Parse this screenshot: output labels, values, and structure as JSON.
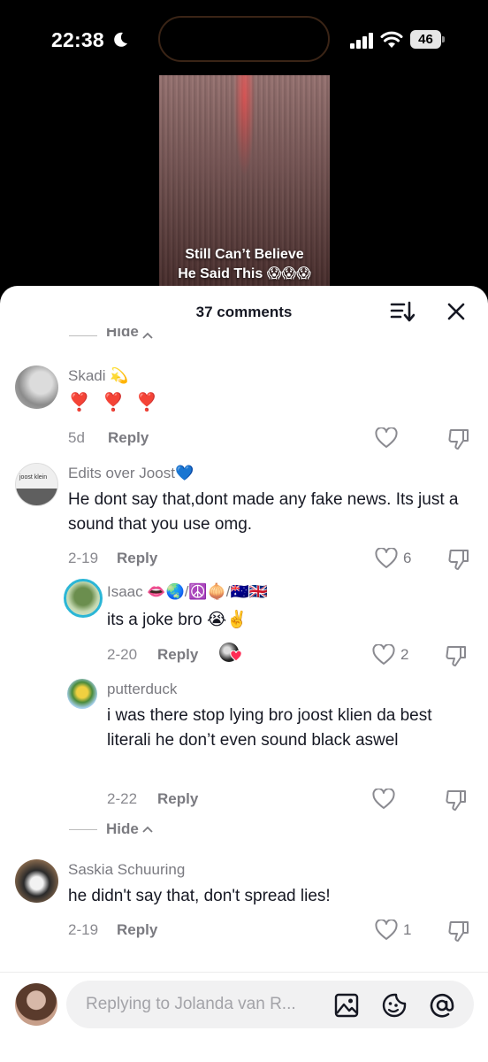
{
  "status_bar": {
    "time": "22:38",
    "battery": "46"
  },
  "video": {
    "caption_line1": "Still Can’t Believe",
    "caption_line2": "He Said This 😱😱😱"
  },
  "header": {
    "title": "37 comments"
  },
  "hide_label": "Hide",
  "comments": [
    {
      "username": "Skadi 💫",
      "text": "❣️ ❣️ ❣️",
      "date": "5d",
      "reply": "Reply",
      "likes": ""
    },
    {
      "username": "Edits over Joost💙",
      "text": "He dont say that,dont made any fake news. Its just a sound that you use omg.",
      "date": "2-19",
      "reply": "Reply",
      "likes": "6",
      "avatar_text": "joost klein"
    },
    {
      "username": "Isaac 👄🌏/☮️🧅/🇦🇺🇬🇧",
      "text": "its a joke bro 😭✌️",
      "date": "2-20",
      "reply": "Reply",
      "likes": "2"
    },
    {
      "username": "putterduck",
      "text": "i was there stop lying bro joost klien da best literali he don’t even sound black aswel",
      "date": "2-22",
      "reply": "Reply",
      "likes": ""
    },
    {
      "username": "Saskia Schuuring",
      "text": "he didn't say that, don't spread lies!",
      "date": "2-19",
      "reply": "Reply",
      "likes": "1"
    }
  ],
  "reply_bar": {
    "placeholder": "Replying to Jolanda van R..."
  }
}
